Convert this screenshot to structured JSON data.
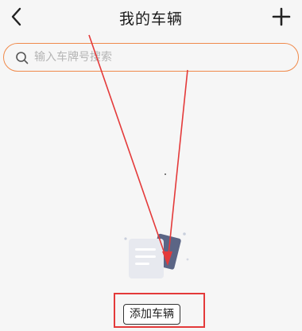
{
  "header": {
    "title": "我的车辆",
    "back_icon": "chevron-left-icon",
    "add_icon": "plus-icon"
  },
  "search": {
    "placeholder": "输入车牌号搜索",
    "value": "",
    "icon": "search-icon",
    "border_color": "#f08a4b"
  },
  "empty_state": {
    "illustration_icon": "empty-document-icon",
    "add_button_label": "添加车辆"
  },
  "annotation": {
    "color": "#e43a3a"
  }
}
